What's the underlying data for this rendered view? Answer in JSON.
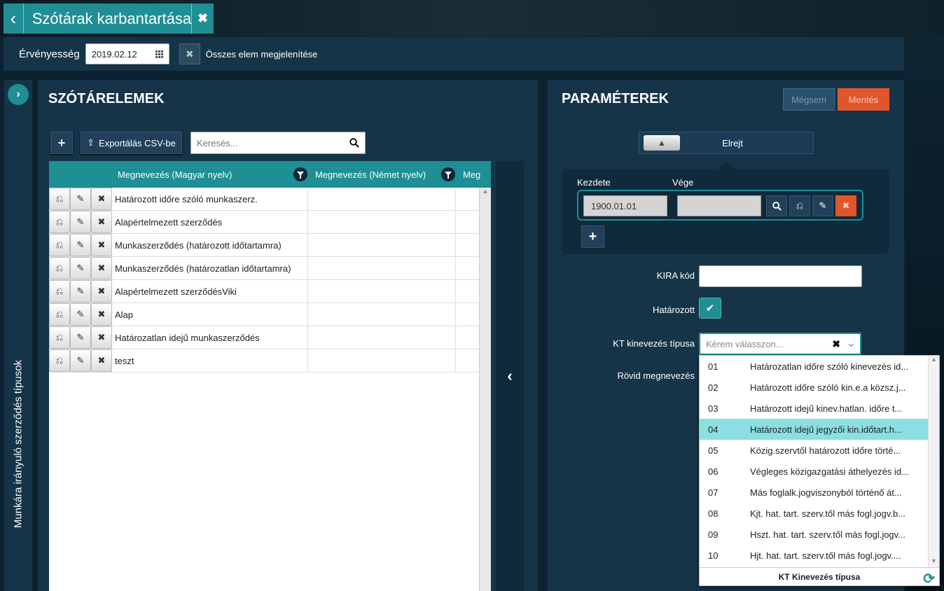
{
  "titlebar": {
    "title": "Szótárak karbantartása",
    "back_icon": "‹",
    "close_icon": "✖"
  },
  "filterbar": {
    "validity_label": "Érvényesség",
    "validity_date": "2019.02.12",
    "show_all_label": "Összes elem megjelenítése"
  },
  "side_tab": {
    "label": "Munkára irányuló szerződés típusok"
  },
  "left": {
    "title": "SZÓTÁRELEMEK",
    "add_label": "+",
    "export_label": "Exportálás CSV-be",
    "search_placeholder": "Keresés...",
    "columns": [
      "Megnevezés (Magyar nyelv)",
      "Megnevezés (Német nyelv)",
      "Meg"
    ],
    "rows": [
      {
        "name": "Határozott időre szóló munkaszerz."
      },
      {
        "name": "Alapértelmezett szerződés"
      },
      {
        "name": "Munkaszerződés (határozott időtartamra)"
      },
      {
        "name": "Munkaszerződés (határozatlan időtartamra)"
      },
      {
        "name": "Alapértelmezett szerződésViki"
      },
      {
        "name": "Alap"
      },
      {
        "name": "Határozatlan idejű munkaszerződés"
      },
      {
        "name": "teszt"
      }
    ]
  },
  "right": {
    "title": "PARAMÉTEREK",
    "cancel_label": "Mégsem",
    "save_label": "Mentés",
    "hide_label": "Elrejt",
    "start_label": "Kezdete",
    "end_label": "Vége",
    "start_value": "1900.01.01",
    "end_value": "",
    "kira_label": "KIRA kód",
    "kira_value": "",
    "fixed_label": "Határozott",
    "fixed_checked": true,
    "kt_label": "KT kinevezés típusa",
    "kt_placeholder": "Kérem válasszon...",
    "short_name_label": "Rövid megnevezés"
  },
  "dropdown": {
    "selected_index": 3,
    "items": [
      {
        "code": "01",
        "name": "Határozatlan időre szóló kinevezés id..."
      },
      {
        "code": "02",
        "name": "Határozott időre szóló kin.e.a közsz.j..."
      },
      {
        "code": "03",
        "name": "Határozott idejű kinev.hatlan. időre t..."
      },
      {
        "code": "04",
        "name": "Határozott idejű jegyzői kin.időtart.h..."
      },
      {
        "code": "05",
        "name": "Közig.szervtől határozott időre törté..."
      },
      {
        "code": "06",
        "name": "Végleges közigazgatási áthelyezés id..."
      },
      {
        "code": "07",
        "name": "Más foglalk.jogviszonyból történő át..."
      },
      {
        "code": "08",
        "name": "Kjt. hat. tart. szerv.től más fogl.jogv.b..."
      },
      {
        "code": "09",
        "name": "Hszt. hat. tart. szerv.től más fogl.jogv..."
      },
      {
        "code": "10",
        "name": "Hjt. hat. tart. szerv.től más fogl.jogv...."
      }
    ],
    "footer": "KT Kinevezés típusa"
  },
  "colors": {
    "teal": "#1f8e95",
    "panel": "#163448",
    "save": "#e0552c",
    "selected": "#8bdfe0"
  }
}
